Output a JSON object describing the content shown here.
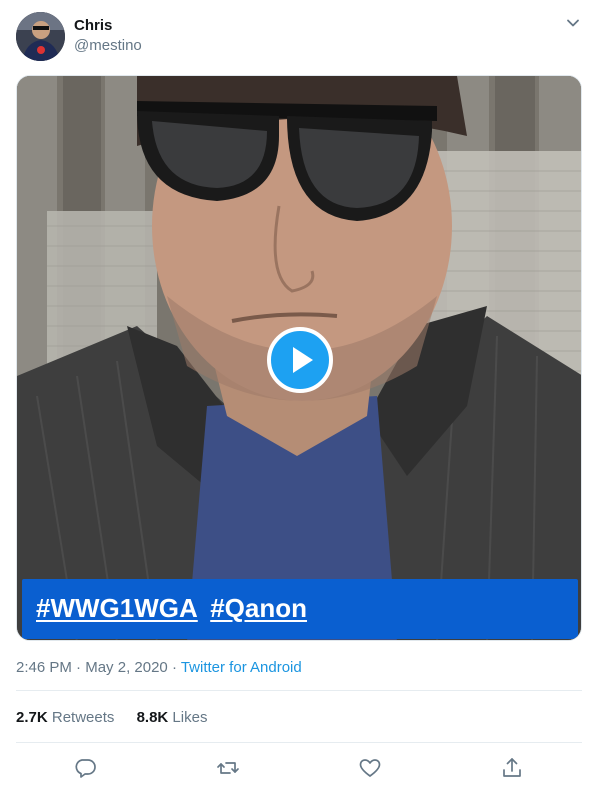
{
  "author": {
    "display_name": "Chris",
    "handle": "@mestino"
  },
  "media": {
    "hashtags": [
      "#WWG1WGA",
      "#Qanon"
    ]
  },
  "meta": {
    "time": "2:46 PM",
    "separator1": " · ",
    "date": "May 2, 2020",
    "separator2": " · ",
    "source": "Twitter for Android"
  },
  "stats": {
    "retweets_count": "2.7K",
    "retweets_label": "Retweets",
    "likes_count": "8.8K",
    "likes_label": "Likes"
  },
  "actions": [
    "reply-icon",
    "retweet-icon",
    "like-icon",
    "share-icon"
  ],
  "colors": {
    "accent": "#1da1f2",
    "link": "#1b95e0",
    "banner": "#0a5fd0",
    "secondary_text": "#657786"
  }
}
